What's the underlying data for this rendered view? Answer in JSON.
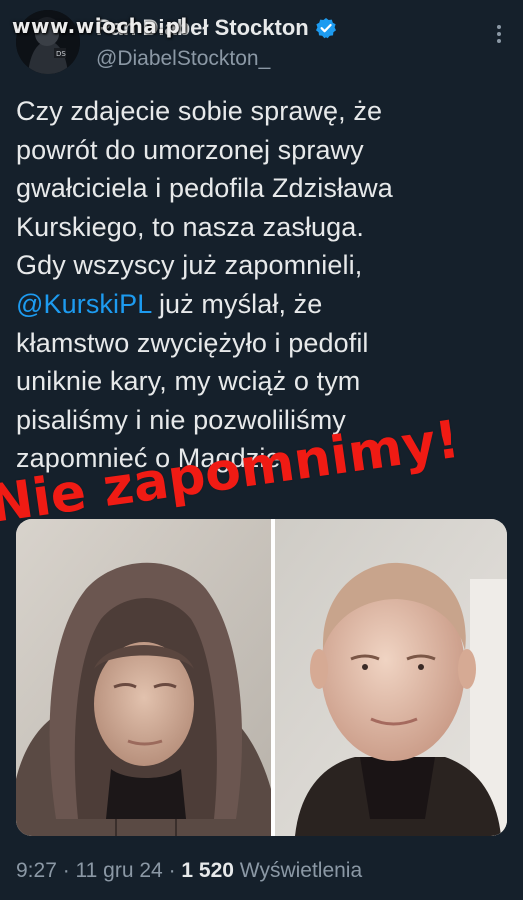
{
  "watermark": "www.wiocha.pl",
  "author": {
    "name": "Pan Diabeł Stockton",
    "handle": "@DiabelStockton_",
    "avatar_initials": "DS",
    "verified_color": "#1d9bf0"
  },
  "tweet": {
    "line1": "Czy zdajecie sobie sprawę, że",
    "line2": "powrót do umorzonej sprawy",
    "line3": "gwałciciela i pedofila Zdzisława",
    "line4": "Kurskiego, to nasza zasługa.",
    "line5": "Gdy wszyscy już zapomnieli,",
    "mention": "@KurskiPL",
    "line6_rest": " już myślał, że",
    "line7": "kłamstwo zwyciężyło i pedofil",
    "line8": "uniknie kary, my wciąż o tym",
    "line9": "pisaliśmy i nie pozwoliliśmy",
    "line10": "zapomnieć o Magdzie."
  },
  "media": {
    "overlay_text": "Nie zapomnimy!",
    "overlay_color": "#f01b14"
  },
  "meta": {
    "time": "9:27",
    "sep1": " · ",
    "date": "11 gru 24",
    "sep2": " · ",
    "views_count": "1 520",
    "views_label": " Wyświetlenia"
  },
  "icons": {
    "verified": "verified-badge-icon",
    "more": "more-options-icon"
  }
}
